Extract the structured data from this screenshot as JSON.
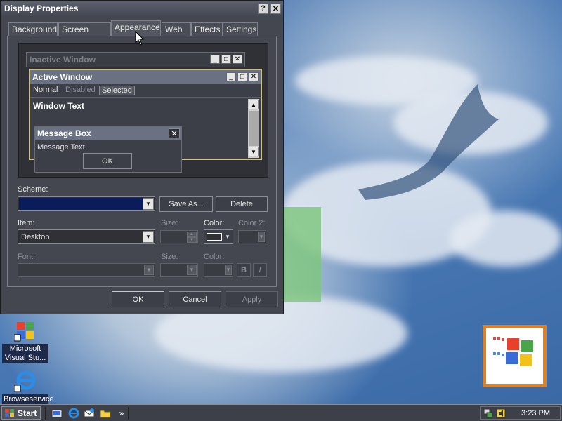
{
  "window": {
    "title": "Display Properties",
    "help_btn": "?",
    "close_btn": "✕"
  },
  "tabs": [
    {
      "label": "Background"
    },
    {
      "label": "Screen Saver"
    },
    {
      "label": "Appearance",
      "active": true
    },
    {
      "label": "Web"
    },
    {
      "label": "Effects"
    },
    {
      "label": "Settings"
    }
  ],
  "preview": {
    "inactive_title": "Inactive Window",
    "active_title": "Active Window",
    "menu_normal": "Normal",
    "menu_disabled": "Disabled",
    "menu_selected": "Selected",
    "window_text": "Window Text",
    "msgbox_title": "Message Box",
    "msgbox_text": "Message Text",
    "msgbox_ok": "OK"
  },
  "scheme": {
    "label": "Scheme:",
    "value": "",
    "save_as": "Save As...",
    "delete": "Delete",
    "swatch_color": "#0a1c5a"
  },
  "item": {
    "label": "Item:",
    "value": "Desktop",
    "size_label": "Size:",
    "color_label": "Color:",
    "color2_label": "Color 2:"
  },
  "font": {
    "label": "Font:",
    "size_label": "Size:",
    "color_label": "Color:",
    "bold": "B",
    "italic": "I"
  },
  "footer": {
    "ok": "OK",
    "cancel": "Cancel",
    "apply": "Apply"
  },
  "desktop_icons": [
    {
      "label": "Microsoft Visual Stu...",
      "icon": "visual-studio-icon"
    },
    {
      "label": "Browseservice",
      "icon": "internet-explorer-icon"
    }
  ],
  "taskbar": {
    "start": "Start",
    "quicklaunch": [
      "desktop-icon",
      "ie-icon",
      "outlook-icon",
      "folder-icon"
    ],
    "overflow": "»",
    "time": "3:23 PM"
  },
  "colors": {
    "window_bg": "#44474f",
    "accent_border": "#cfc08a",
    "logo_border": "#e08020"
  }
}
